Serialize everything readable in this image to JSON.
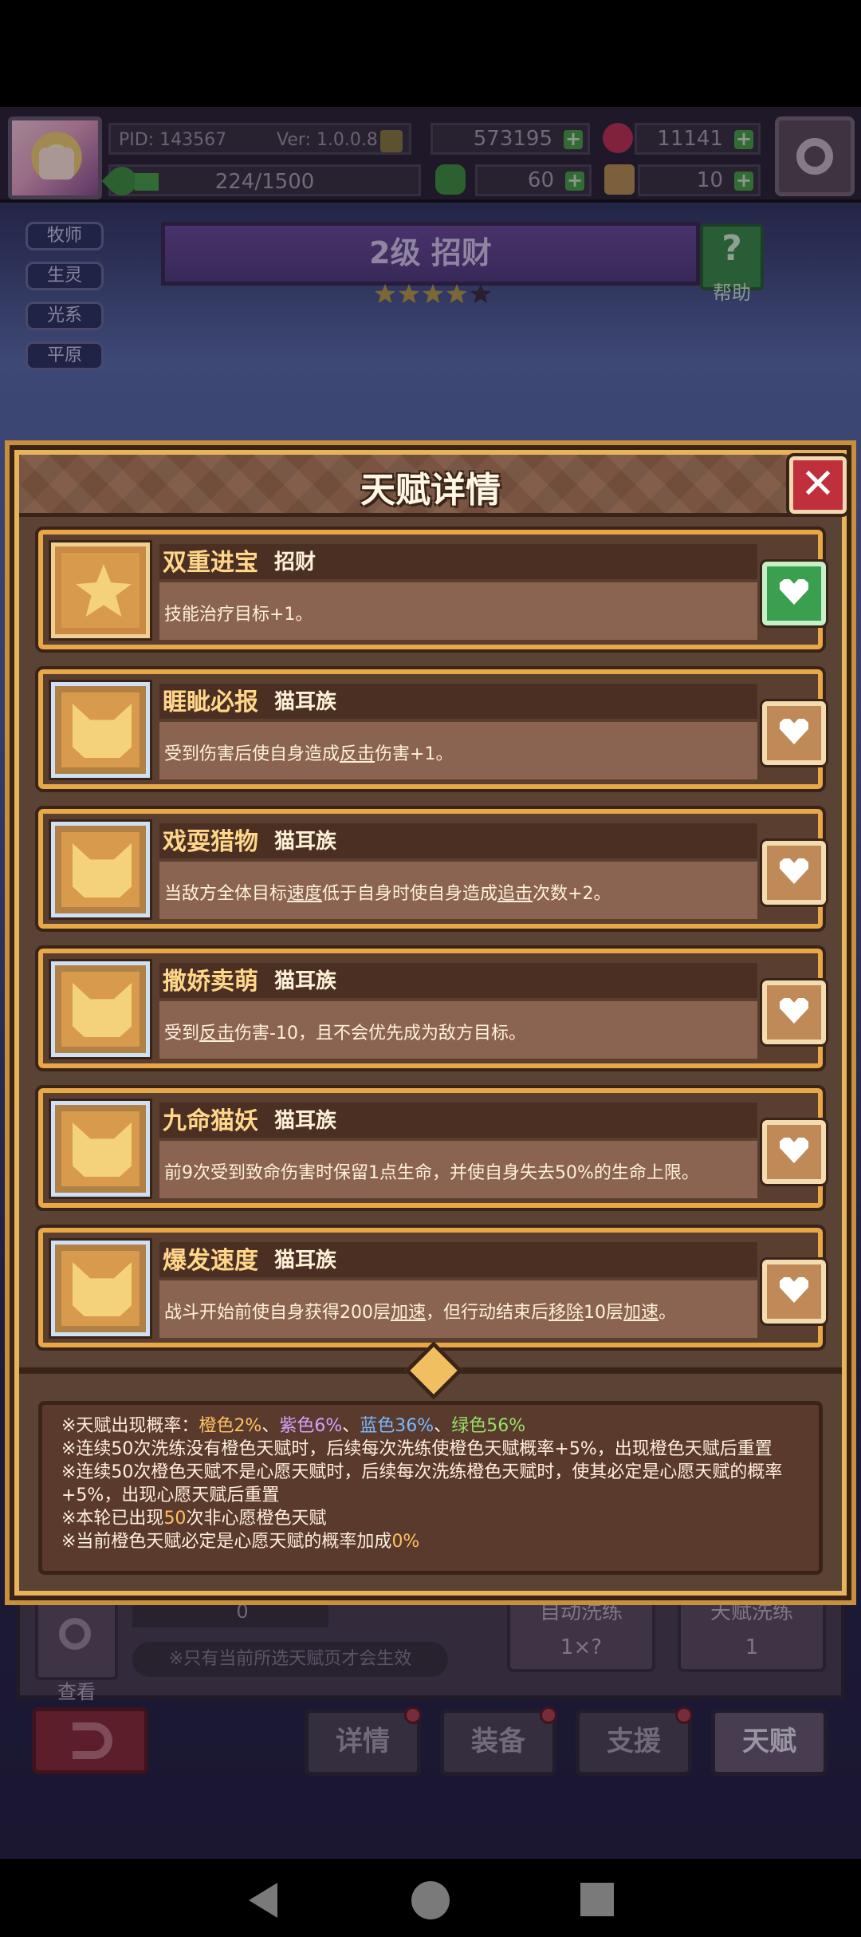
{
  "hud": {
    "pid": "PID: 143567",
    "version": "Ver: 1.0.0.8",
    "exp": "224/1500",
    "gold": "573195",
    "gems": "11141",
    "clover": "60",
    "tickets": "10"
  },
  "class_tags": [
    "牧师",
    "生灵",
    "光系",
    "平原"
  ],
  "banner": {
    "title": "2级 招财",
    "help_label": "帮助",
    "help_icon": "?"
  },
  "dialog": {
    "title": "天赋详情",
    "close": "✕",
    "talents": [
      {
        "name": "双重进宝",
        "tag": "招财",
        "icon": "star-icon",
        "desc_parts": [
          "技能治疗目标+1。"
        ],
        "wish": true
      },
      {
        "name": "睚眦必报",
        "tag": "猫耳族",
        "icon": "cat-icon",
        "desc_parts": [
          "受到伤害后使自身造成",
          "反击",
          "伤害+1。"
        ],
        "wish": false
      },
      {
        "name": "戏耍猎物",
        "tag": "猫耳族",
        "icon": "cat-icon",
        "desc_parts": [
          "当敌方全体目标",
          "速度",
          "低于自身时使自身造成",
          "追击",
          "次数+2。"
        ],
        "wish": false
      },
      {
        "name": "撒娇卖萌",
        "tag": "猫耳族",
        "icon": "cat-icon",
        "desc_parts": [
          "受到",
          "反击",
          "伤害-10，且不会优先成为敌方目标。"
        ],
        "wish": false
      },
      {
        "name": "九命猫妖",
        "tag": "猫耳族",
        "icon": "cat-icon",
        "desc_parts": [
          "前9次受到致命伤害时保留1点生命，并使自身失去50%的生命上限。"
        ],
        "wish": false
      },
      {
        "name": "爆发速度",
        "tag": "猫耳族",
        "icon": "cat-icon",
        "desc_parts": [
          "战斗开始前使自身获得200层",
          "加速",
          "，但行动结束后",
          "移除",
          "10层",
          "加速",
          "。"
        ],
        "wish": false
      }
    ],
    "notes": {
      "rates_prefix": "※天赋出现概率：",
      "orange": "橙色2%",
      "sep1": "、",
      "purple": "紫色6%",
      "sep2": "、",
      "blue": "蓝色36%",
      "sep3": "、",
      "green": "绿色56%",
      "line2": "※连续50次洗练没有橙色天赋时，后续每次洗练使橙色天赋概率+5%，出现橙色天赋后重置",
      "line3a": "※连续50次橙色天赋不是心愿天赋时，后续每次洗练橙色天赋时，使其必定是心愿天赋的概率",
      "line3b": "+5%，出现心愿天赋后重置",
      "line4a": "※本轮已出现",
      "line4n": "50",
      "line4b": "次非心愿橙色天赋",
      "line5a": "※当前橙色天赋必定是心愿天赋的概率加成",
      "line5n": "0%"
    }
  },
  "bottom": {
    "view_label": "查看",
    "count": "0",
    "tip": "※只有当前所选天赋页才会生效",
    "auto_reroll": "自动洗练",
    "auto_cost": "1×?",
    "talent_reroll": "天赋洗练",
    "talent_cost": "1"
  },
  "tabs": [
    "详情",
    "装备",
    "支援",
    "天赋"
  ],
  "colors": {
    "frame": "#e6b45a",
    "panel": "#5a4234",
    "accent_orange": "#ffc060",
    "close_red": "#c0303c",
    "wish_green": "#3aa050"
  }
}
